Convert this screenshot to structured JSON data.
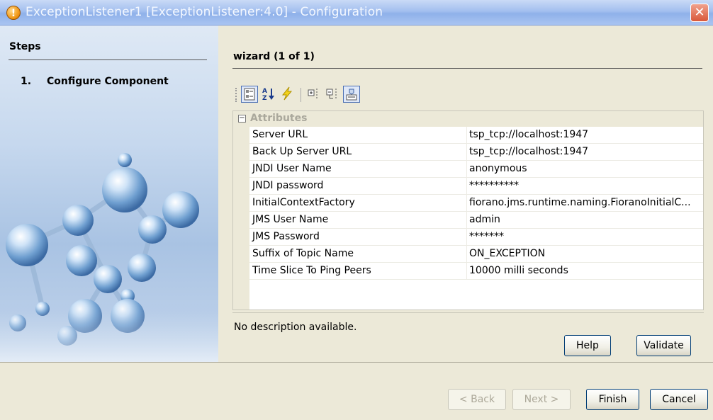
{
  "window": {
    "title": "ExceptionListener1 [ExceptionListener:4.0] - Configuration",
    "close_symbol": "✕"
  },
  "steps": {
    "heading": "Steps",
    "items": [
      {
        "number": "1.",
        "label": "Configure Component"
      }
    ]
  },
  "wizard": {
    "heading": "wizard (1 of 1)"
  },
  "toolbar": {
    "icons": [
      "categorized-view-icon",
      "sort-alphabetical-icon",
      "events-icon",
      "expand-all-icon",
      "collapse-all-icon",
      "description-icon"
    ]
  },
  "grid": {
    "category": "Attributes",
    "toggle": "−",
    "rows": [
      {
        "name": "Server URL",
        "value": "tsp_tcp://localhost:1947"
      },
      {
        "name": "Back Up Server URL",
        "value": "tsp_tcp://localhost:1947"
      },
      {
        "name": "JNDI User Name",
        "value": "anonymous"
      },
      {
        "name": "JNDI password",
        "value": "**********"
      },
      {
        "name": "InitialContextFactory",
        "value": "fiorano.jms.runtime.naming.FioranoInitialC..."
      },
      {
        "name": "JMS User Name",
        "value": "admin"
      },
      {
        "name": "JMS Password",
        "value": "*******"
      },
      {
        "name": "Suffix of Topic Name",
        "value": "ON_EXCEPTION"
      },
      {
        "name": "Time Slice To Ping Peers",
        "value": "10000  milli seconds"
      }
    ]
  },
  "description": "No description available.",
  "buttons": {
    "help": "Help",
    "validate": "Validate",
    "back": "< Back",
    "next": "Next >",
    "finish": "Finish",
    "cancel": "Cancel"
  }
}
